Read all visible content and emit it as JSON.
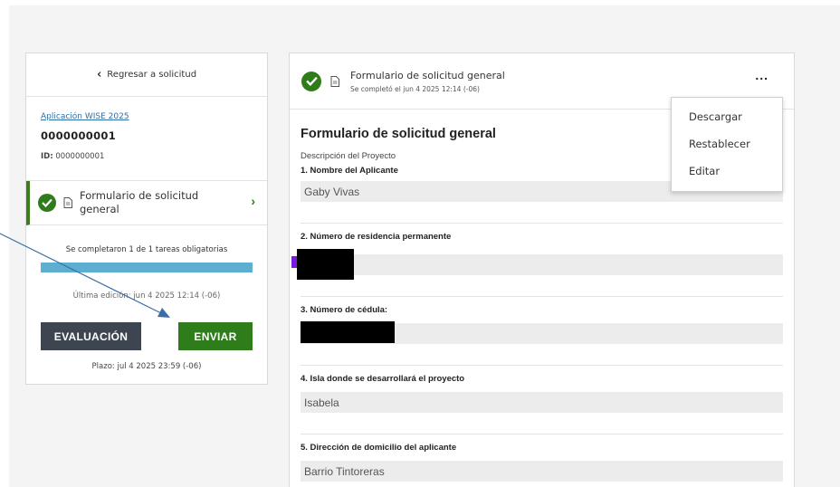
{
  "left": {
    "back_label": "Regresar a solicitud",
    "app_link": "Aplicación WISE 2025",
    "app_number": "0000000001",
    "id_label": "ID:",
    "id_value": "0000000001",
    "task_label": "Formulario de solicitud general",
    "progress_text": "Se completaron 1 de 1 tareas obligatorias",
    "progress_fraction": 1.0,
    "last_edit": "Última edición: jun 4 2025 12:14 (-06)",
    "eval_button": "EVALUACIÓN",
    "send_button": "ENVIAR",
    "deadline": "Plazo: jul 4 2025 23:59 (-06)"
  },
  "header": {
    "title": "Formulario de solicitud general",
    "subtitle": "Se completó el jun 4 2025 12:14 (-06)",
    "more": "..."
  },
  "form": {
    "title": "Formulario de solicitud general",
    "description": "Descripción del Proyecto",
    "questions": [
      {
        "label": "1. Nombre del Aplicante",
        "answer": "Gaby Vivas"
      },
      {
        "label": "2. Número de residencia permanente",
        "answer": ""
      },
      {
        "label": "3. Número de cédula:",
        "answer": ""
      },
      {
        "label": "4. Isla donde se desarrollará el proyecto",
        "answer": "Isabela"
      },
      {
        "label": "5. Dirección de domicilio del aplicante",
        "answer": "Barrio Tintoreras"
      }
    ]
  },
  "menu": {
    "items": [
      "Descargar",
      "Restablecer",
      "Editar"
    ]
  },
  "colors": {
    "accent_green": "#2f7d1a",
    "progress_blue": "#5daed0",
    "dark_button": "#3d4650",
    "link_blue": "#2f6ea6"
  },
  "icons": [
    "chevron-left-icon",
    "check-circle-icon",
    "document-icon",
    "chevron-right-icon",
    "more-icon"
  ]
}
